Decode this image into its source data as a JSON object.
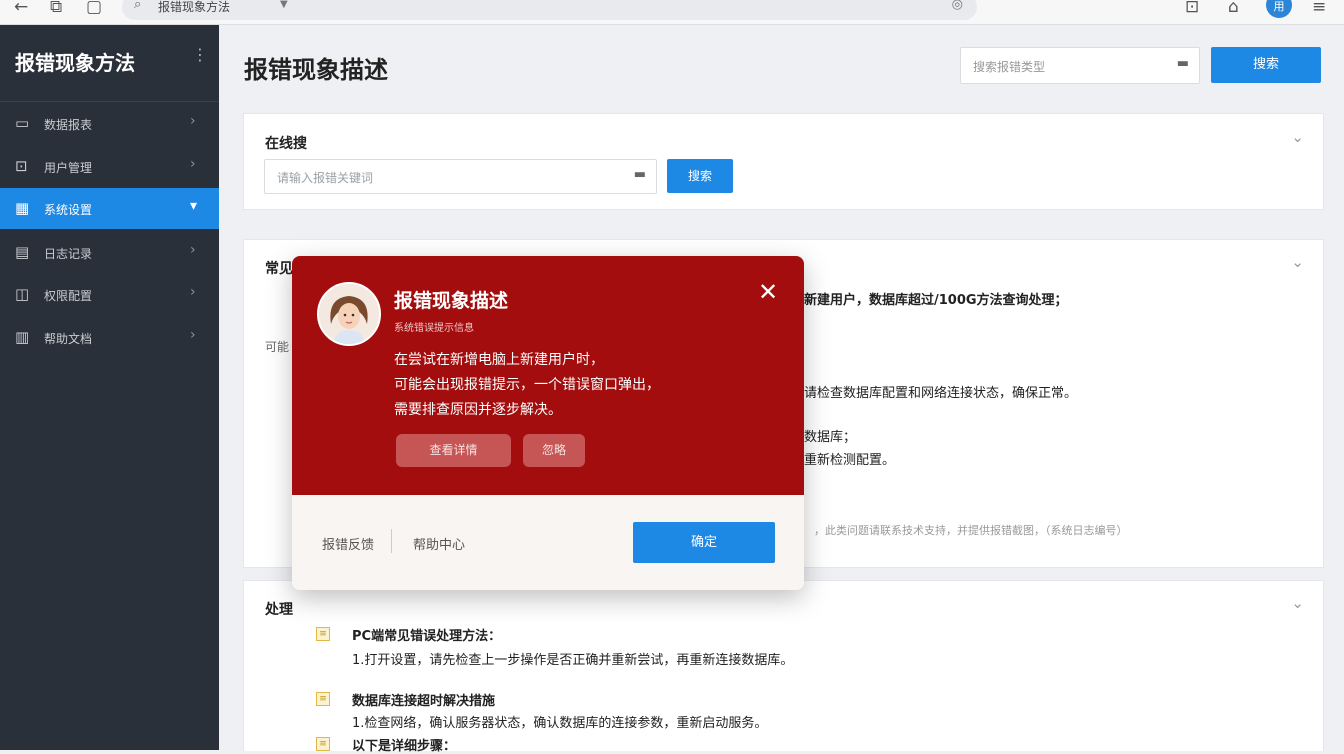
{
  "browser": {
    "url_text": "报错现象方法",
    "avatar_text": "用"
  },
  "sidebar": {
    "title": "报错现象方法",
    "items": [
      {
        "label": "数据报表",
        "icon": "▭"
      },
      {
        "label": "用户管理",
        "icon": "⊡"
      },
      {
        "label": "系统设置",
        "icon": "▦"
      },
      {
        "label": "日志记录",
        "icon": "▤"
      },
      {
        "label": "权限配置",
        "icon": "◫"
      },
      {
        "label": "帮助文档",
        "icon": "▥"
      }
    ]
  },
  "header": {
    "title": "报错现象描述",
    "search_placeholder": "搜索报错类型",
    "search_button": "搜索"
  },
  "card1": {
    "title": "在线搜",
    "input_placeholder": "请输入报错关键词",
    "button": "搜索"
  },
  "card2": {
    "title": "常见",
    "lines": [
      "新建用户，数据库超过/100G方法查询处理；",
      "请检查数据库配置和网络连接状态，确保正常。",
      "数据库；",
      "重新检测配置。"
    ],
    "left_label": "可能",
    "faint_line": "，此类问题请联系技术支持，并提供报错截图，（系统日志编号）"
  },
  "card3": {
    "title": "处理",
    "items": [
      {
        "head": "PC端常见错误处理方法：",
        "detail": "1.打开设置，请先检查上一步操作是否正确并重新尝试，再重新连接数据库。"
      },
      {
        "head": "数据库连接超时解决措施",
        "detail": "1.检查网络，确认服务器状态，确认数据库的连接参数，重新启动服务。"
      },
      {
        "head": "以下是详细步骤：",
        "detail": ""
      }
    ]
  },
  "dialog": {
    "title": "报错现象描述",
    "subtitle": "系统错误提示信息",
    "message_lines": [
      "在尝试在新增电脑上新建用户时，",
      "可能会出现报错提示，一个错误窗口弹出，",
      "需要排查原因并逐步解决。"
    ],
    "btn_detail": "查看详情",
    "btn_ignore": "忽略",
    "link_feedback": "报错反馈",
    "link_help": "帮助中心",
    "confirm": "确定"
  },
  "colors": {
    "accent": "#1e88e5",
    "sidebar_bg": "#2a3039",
    "dialog_red": "#a30d0d"
  }
}
